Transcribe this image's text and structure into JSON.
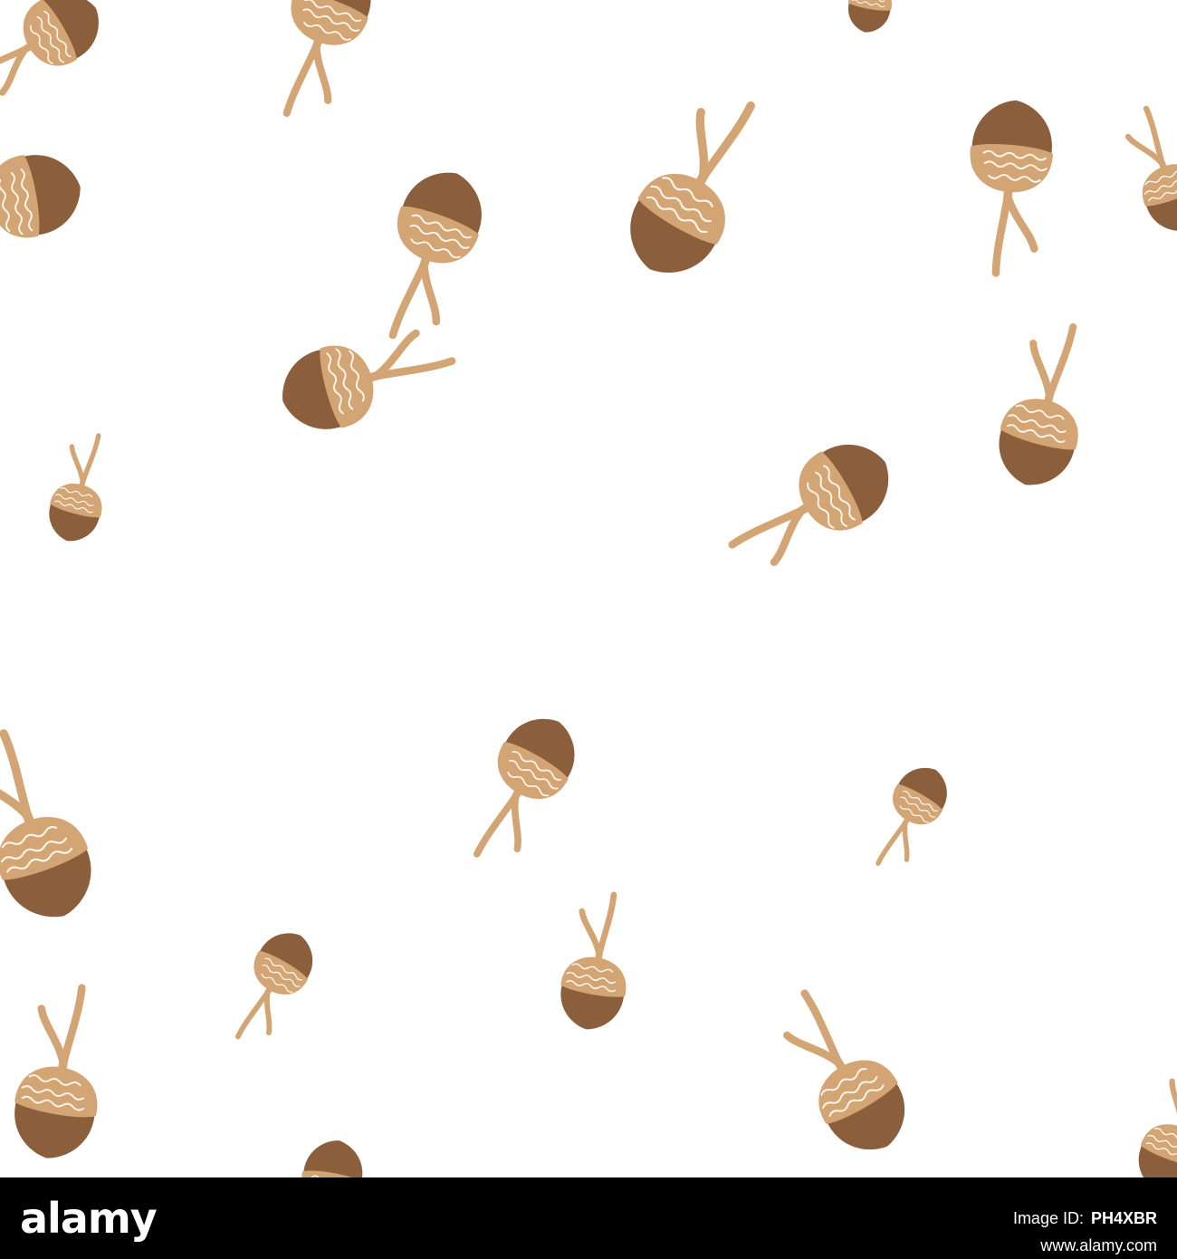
{
  "colors": {
    "background": "#ffffff",
    "nut": "#8b5e3c",
    "cap": "#d4a574",
    "cap_texture": "#fdf6ec",
    "stem": "#d4a574",
    "footer": "#000000",
    "footer_text": "#ffffff"
  },
  "pattern": {
    "motif": "acorn-icon",
    "count": 22
  },
  "footer": {
    "brand": "alamy",
    "url_label": "www.alamy.com",
    "image_id_label": "Image ID:",
    "image_id": "PH4XBR"
  }
}
